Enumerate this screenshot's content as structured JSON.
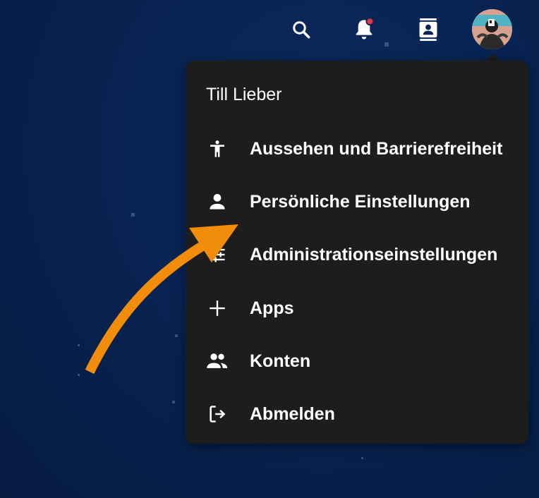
{
  "colors": {
    "background": "#082352",
    "menu_background": "#1d1d1d",
    "text": "#ffffff",
    "notification_dot": "#e0393e",
    "annotation_arrow": "#f18d0b"
  },
  "header": {
    "icons": [
      "search-icon",
      "bell-icon",
      "contacts-icon"
    ],
    "avatar": "user-avatar"
  },
  "menu": {
    "user_name": "Till Lieber",
    "items": [
      {
        "label": "Aussehen und Barrierefreiheit",
        "icon": "accessibility-icon"
      },
      {
        "label": "Persönliche Einstellungen",
        "icon": "person-icon"
      },
      {
        "label": "Administrationseinstellungen",
        "icon": "admin-settings-icon"
      },
      {
        "label": "Apps",
        "icon": "plus-icon"
      },
      {
        "label": "Konten",
        "icon": "accounts-icon"
      },
      {
        "label": "Abmelden",
        "icon": "logout-icon"
      }
    ]
  },
  "annotation": {
    "type": "arrow",
    "points_to": "Persönliche Einstellungen"
  }
}
